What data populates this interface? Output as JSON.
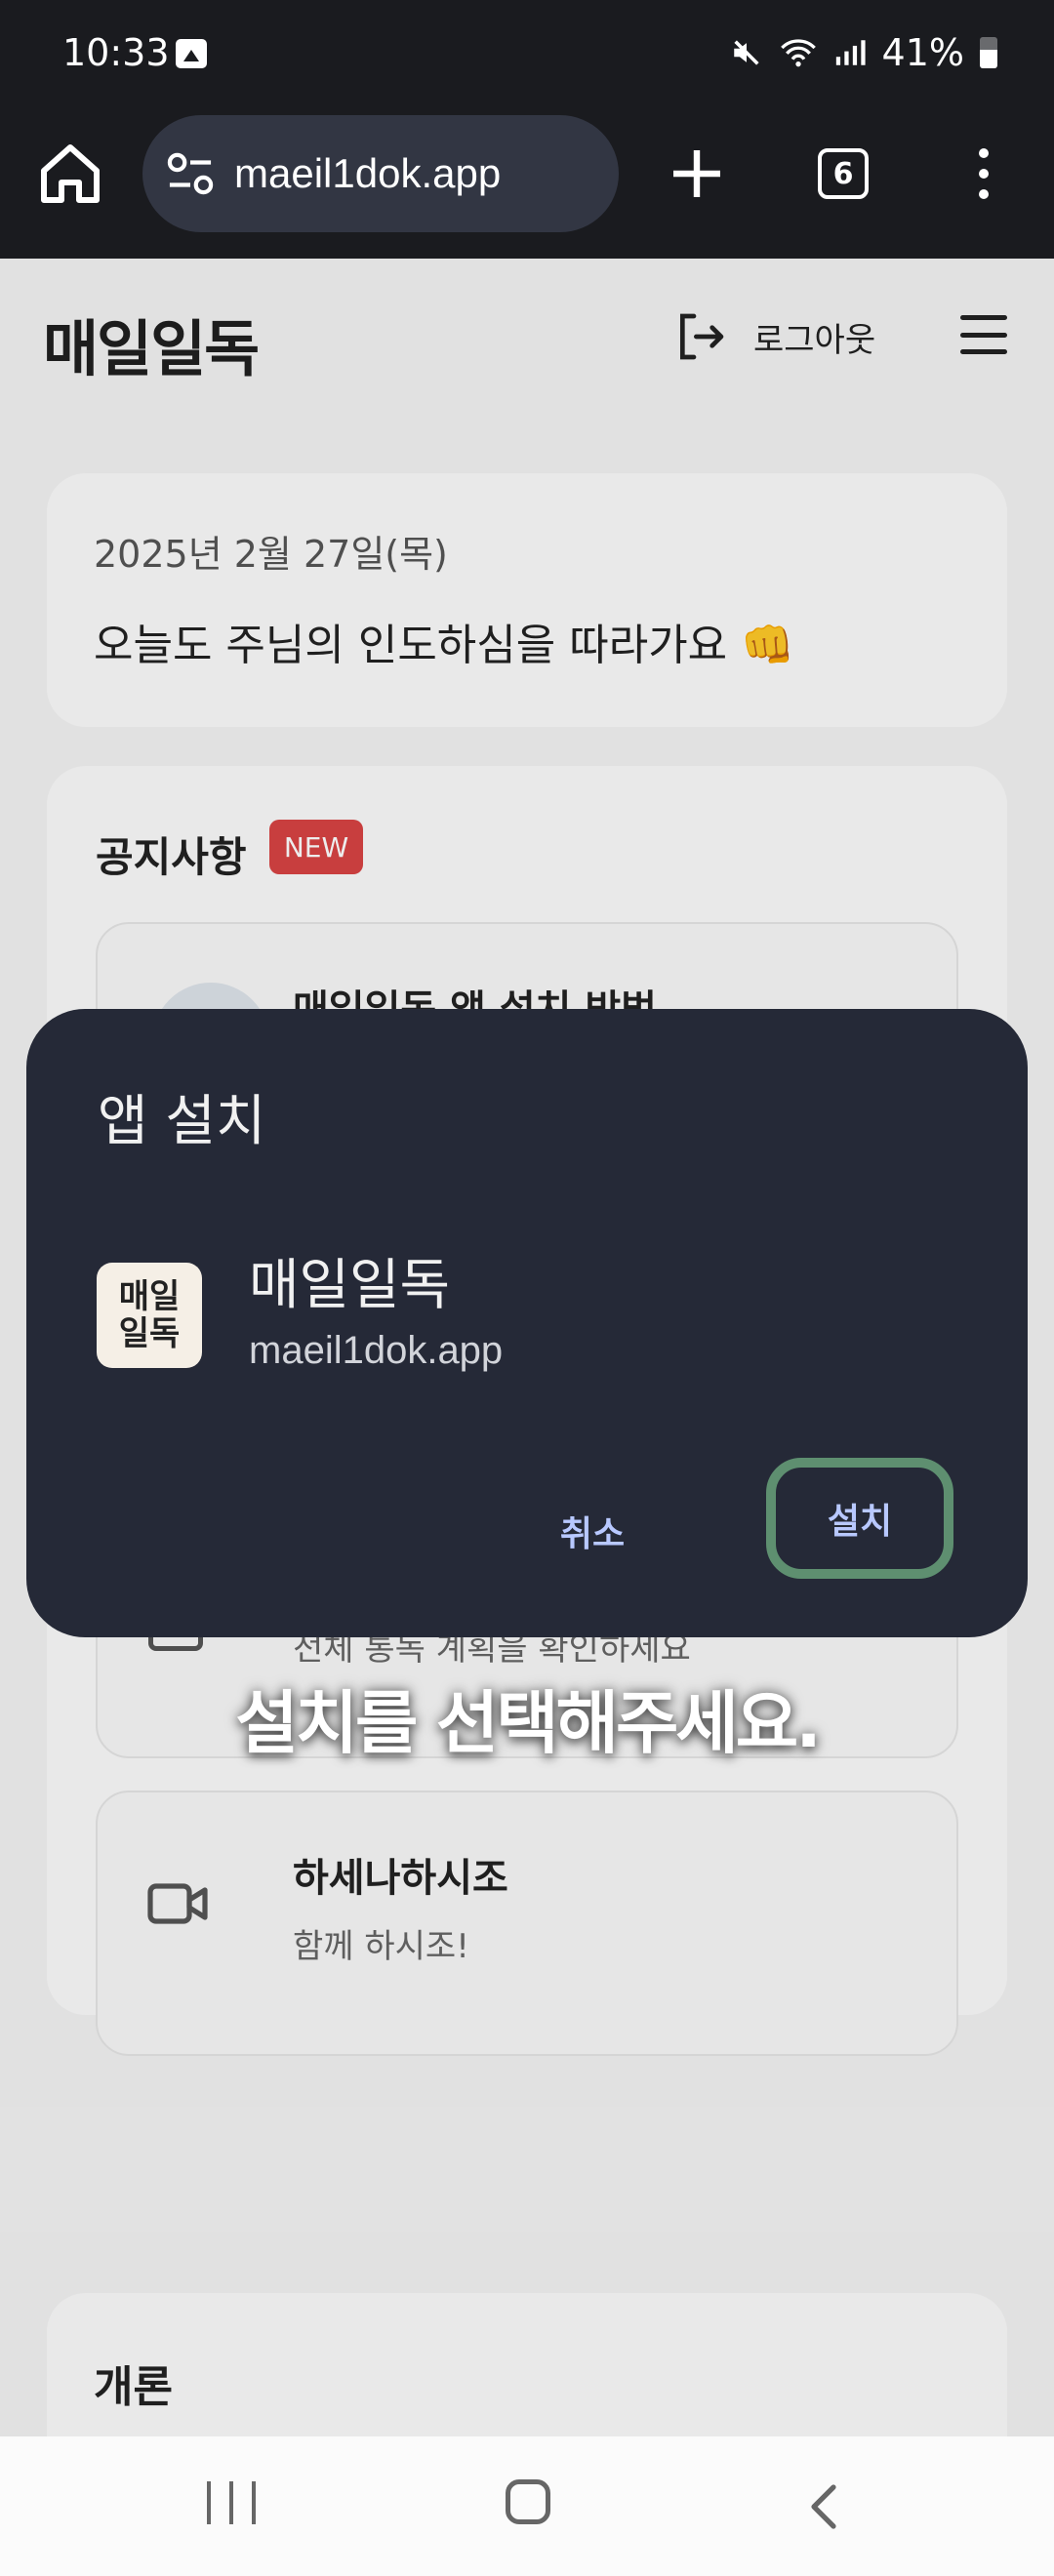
{
  "status_bar": {
    "time": "10:33",
    "battery": "41%",
    "icons": [
      "gallery-icon",
      "mute-icon",
      "wifi-icon",
      "signal-icon",
      "battery-icon"
    ]
  },
  "browser": {
    "url": "maeil1dok.app",
    "tab_count": "6"
  },
  "site": {
    "logo": "매일일독",
    "logout_label": "로그아웃",
    "date": "2025년 2월 27일(목)",
    "daily_message": "오늘도 주님의 인도하심을 따라가요 👊",
    "notice_title": "공지사항",
    "new_badge": "NEW",
    "notice_items": [
      {
        "title": "매일일독 앱 설치 방법",
        "subtitle": ""
      },
      {
        "title": "",
        "subtitle": ""
      },
      {
        "title": "",
        "subtitle": "전체 통독 계획을 확인하세요"
      },
      {
        "title": "하세나하시조",
        "subtitle": "함께 하시조!"
      }
    ],
    "gaeron_title": "개론"
  },
  "dialog": {
    "title": "앱 설치",
    "app_icon_text": [
      "매일",
      "일독"
    ],
    "app_name": "매일일독",
    "app_url": "maeil1dok.app",
    "cancel_label": "취소",
    "install_label": "설치",
    "highlight_color": "#5e8f70"
  },
  "caption": "설치를 선택해주세요."
}
